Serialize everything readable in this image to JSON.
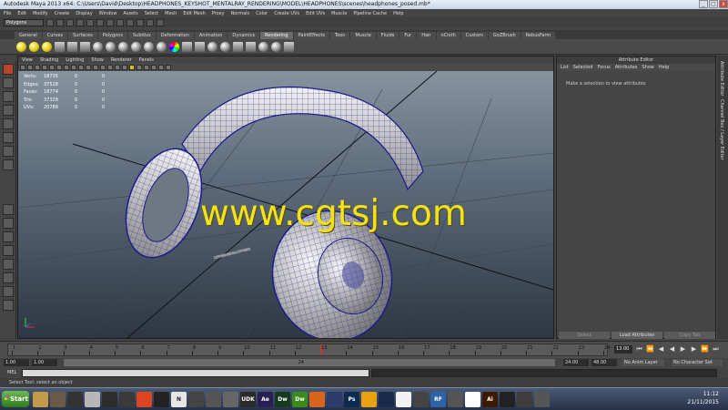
{
  "window": {
    "title": "Autodesk Maya 2013 x64: C:\\Users\\David\\Desktop\\HEADPHONES_KEYSHOT_MENTALRAY_RENDERING\\MODEL\\HEADPHONES\\scenes\\headphones_posed.mb*",
    "controls": [
      "_",
      "□",
      "x"
    ]
  },
  "menubar": [
    "File",
    "Edit",
    "Modify",
    "Create",
    "Display",
    "Window",
    "Assets",
    "Select",
    "Mesh",
    "Edit Mesh",
    "Proxy",
    "Normals",
    "Color",
    "Create UVs",
    "Edit UVs",
    "Muscle",
    "Pipeline Cache",
    "Help"
  ],
  "status_line": {
    "mode": "Polygons"
  },
  "shelf": {
    "tabs": [
      "General",
      "Curves",
      "Surfaces",
      "Polygons",
      "Subdivs",
      "Deformation",
      "Animation",
      "Dynamics",
      "Rendering",
      "PaintEffects",
      "Toon",
      "Muscle",
      "Fluids",
      "Fur",
      "Hair",
      "nCloth",
      "Custom",
      "GoZBrush",
      "RebusFarm"
    ],
    "active_tab": "Rendering"
  },
  "viewport": {
    "menu": [
      "View",
      "Shading",
      "Lighting",
      "Show",
      "Renderer",
      "Panels"
    ],
    "hud": [
      {
        "label": "Verts:",
        "a": "18735",
        "b": "0",
        "c": "0"
      },
      {
        "label": "Edges:",
        "a": "37528",
        "b": "0",
        "c": "0"
      },
      {
        "label": "Faces:",
        "a": "18774",
        "b": "0",
        "c": "0"
      },
      {
        "label": "Tris:",
        "a": "37328",
        "b": "0",
        "c": "0"
      },
      {
        "label": "UVs:",
        "a": "20788",
        "b": "0",
        "c": "0"
      }
    ],
    "watermark": "www.cgtsj.com"
  },
  "attribute_editor": {
    "title": "Attribute Editor",
    "menu": [
      "List",
      "Selected",
      "Focus",
      "Attributes",
      "Show",
      "Help"
    ],
    "message": "Make a selection to view attributes",
    "buttons": {
      "select": "Select",
      "load": "Load Attributes",
      "copy": "Copy Tab"
    }
  },
  "side_tabs": [
    "Attribute Editor",
    "Channel Box / Layer Editor"
  ],
  "time_slider": {
    "ticks": [
      "1",
      "2",
      "3",
      "4",
      "5",
      "6",
      "7",
      "8",
      "9",
      "10",
      "11",
      "12",
      "13",
      "14",
      "15",
      "16",
      "17",
      "18",
      "19",
      "20",
      "21",
      "22",
      "23",
      "24"
    ],
    "current_frame": "13.00"
  },
  "range_slider": {
    "start": "1.00",
    "playback_start": "1.00",
    "playback_end_marker": "24",
    "playback_end": "24.00",
    "end": "48.00",
    "anim_layer": "No Anim Layer",
    "character_set": "No Character Set"
  },
  "command_line": {
    "label": "MEL"
  },
  "help_line": "Select Tool: select an object",
  "taskbar": {
    "start": "Start",
    "apps": [
      {
        "label": "",
        "color": "#c39a4a"
      },
      {
        "label": "",
        "color": "#6c5a48"
      },
      {
        "label": "",
        "color": "#333333"
      },
      {
        "label": "",
        "color": "#b7b7b7"
      },
      {
        "label": "",
        "color": "#2d2d2d"
      },
      {
        "label": "",
        "color": "#3a3a3a"
      },
      {
        "label": "",
        "color": "#dd4422"
      },
      {
        "label": "",
        "color": "#222222"
      },
      {
        "label": "N",
        "color": "#e6e6e6"
      },
      {
        "label": "",
        "color": "#444444"
      },
      {
        "label": "",
        "color": "#555555"
      },
      {
        "label": "",
        "color": "#666666"
      },
      {
        "label": "UDK",
        "color": "#2a2a2a"
      },
      {
        "label": "Ae",
        "color": "#2a1f54"
      },
      {
        "label": "Dw",
        "color": "#173a1f"
      },
      {
        "label": "Dw",
        "color": "#3a8a1c"
      },
      {
        "label": "",
        "color": "#d9641c"
      },
      {
        "label": "",
        "color": "#2b3b6b"
      },
      {
        "label": "Ps",
        "color": "#0d2b4f"
      },
      {
        "label": "",
        "color": "#e8a211"
      },
      {
        "label": "",
        "color": "#1a2a4a"
      },
      {
        "label": "",
        "color": "#f2f2f2"
      },
      {
        "label": "",
        "color": "#444444"
      },
      {
        "label": "RF",
        "color": "#2d63a8"
      },
      {
        "label": "",
        "color": "#555555"
      },
      {
        "label": "",
        "color": "#ffffff"
      },
      {
        "label": "Ai",
        "color": "#3b1a00"
      },
      {
        "label": "",
        "color": "#222222"
      },
      {
        "label": "",
        "color": "#3d3d3d"
      },
      {
        "label": "",
        "color": "#555555"
      }
    ],
    "time": "11:12",
    "date": "21/11/2015"
  }
}
